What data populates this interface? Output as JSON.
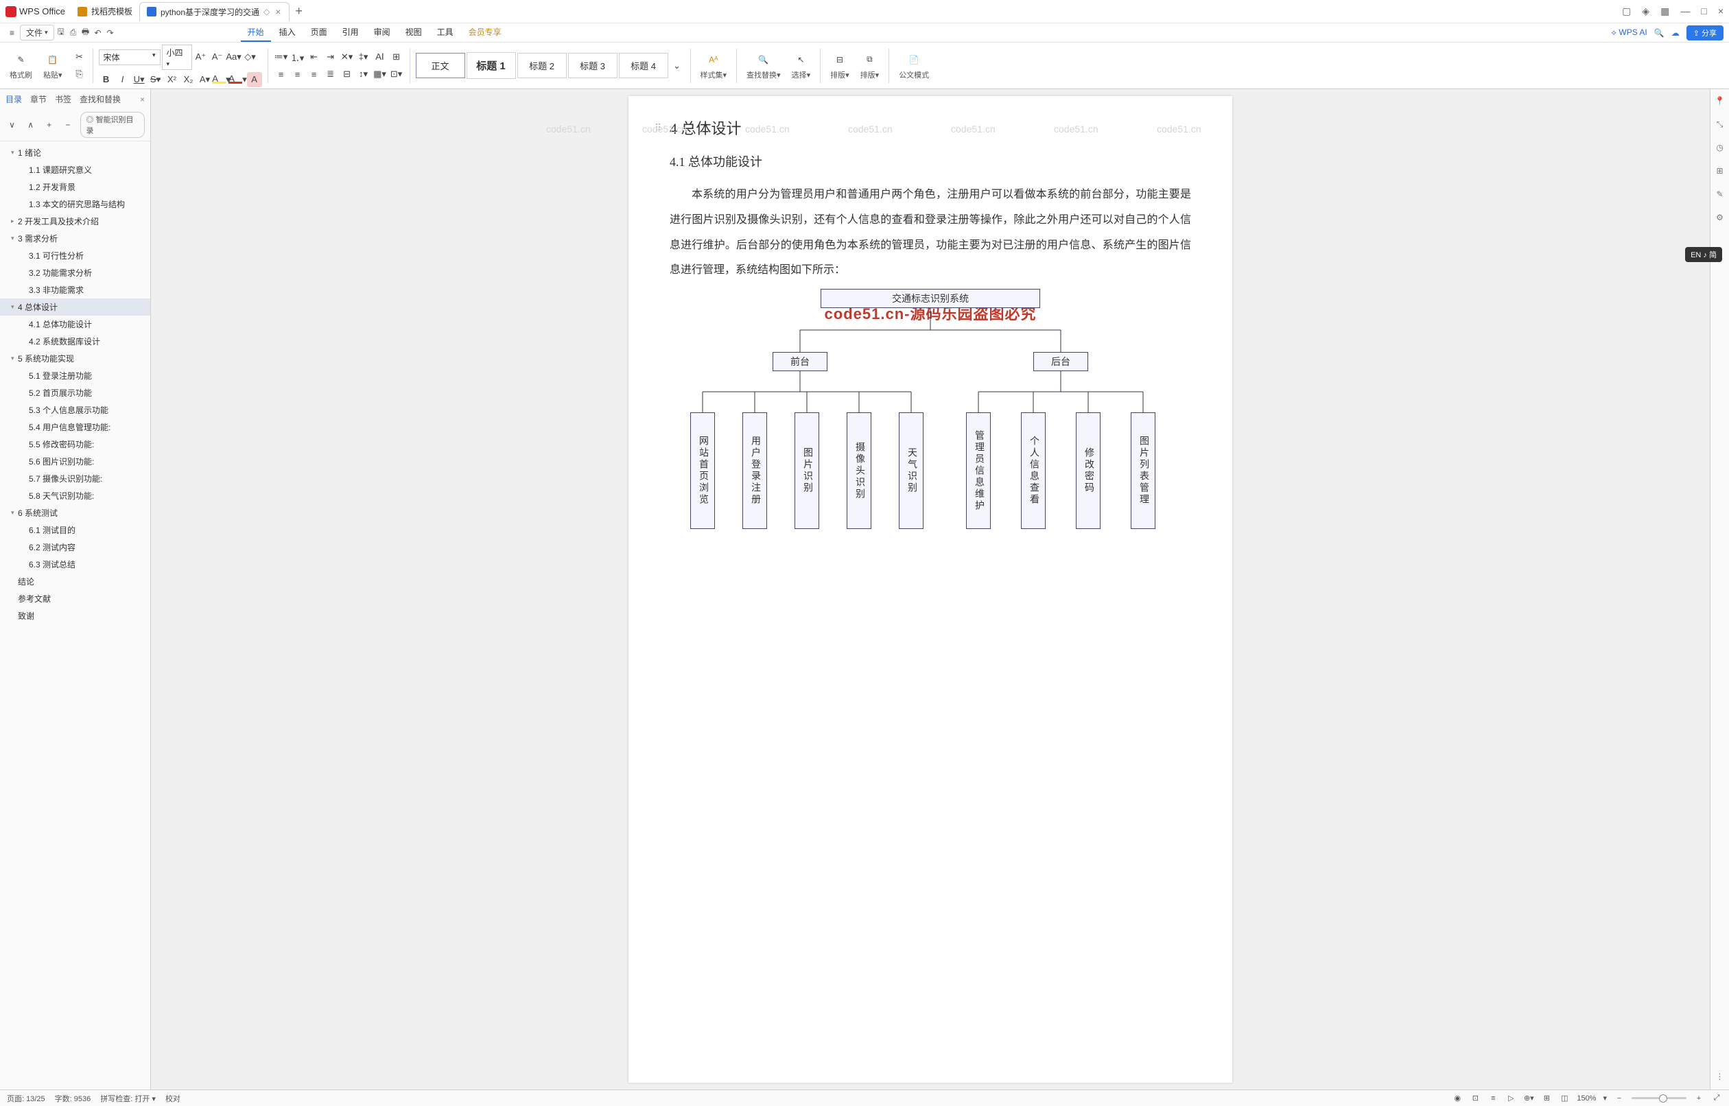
{
  "app": {
    "name": "WPS Office"
  },
  "tabs": [
    {
      "label": "找稻壳模板",
      "icon": "#d48b0c"
    },
    {
      "label": "python基于深度学习的交通",
      "icon": "#2c6fd8",
      "active": true
    }
  ],
  "window_icons": [
    "▢",
    "◈",
    "▦",
    "—",
    "□",
    "×"
  ],
  "file_menu": "文件",
  "quick_icons": [
    "☰",
    "🗋",
    "🖶",
    "↩",
    "↪"
  ],
  "main_tabs": [
    "开始",
    "插入",
    "页面",
    "引用",
    "审阅",
    "视图",
    "工具",
    "会员专享"
  ],
  "wpsai": "WPS AI",
  "share": "分享",
  "ribbon": {
    "format_painter": "格式刷",
    "paste": "粘贴",
    "font_name": "宋体",
    "font_size": "小四",
    "style_set": "样式集",
    "find_replace": "查找替换",
    "select": "选择",
    "arrange": "排版",
    "arrange2": "排版",
    "official": "公文模式",
    "styles": [
      "正文",
      "标题 1",
      "标题 2",
      "标题 3",
      "标题 4"
    ]
  },
  "left_pane": {
    "tabs": [
      "目录",
      "章节",
      "书签",
      "查找和替换"
    ],
    "smart": "智能识别目录",
    "toc": [
      {
        "t": "1 绪论",
        "l": 1,
        "car": "▾"
      },
      {
        "t": "1.1 课题研究意义",
        "l": 2
      },
      {
        "t": "1.2 开发背景",
        "l": 2
      },
      {
        "t": "1.3 本文的研究思路与结构",
        "l": 2
      },
      {
        "t": "2 开发工具及技术介绍",
        "l": 1,
        "car": "▸"
      },
      {
        "t": "3 需求分析",
        "l": 1,
        "car": "▾"
      },
      {
        "t": "3.1 可行性分析",
        "l": 2
      },
      {
        "t": "3.2 功能需求分析",
        "l": 2
      },
      {
        "t": "3.3 非功能需求",
        "l": 2
      },
      {
        "t": "4 总体设计",
        "l": 1,
        "car": "▾",
        "sel": true
      },
      {
        "t": "4.1 总体功能设计",
        "l": 2
      },
      {
        "t": "4.2 系统数据库设计",
        "l": 2
      },
      {
        "t": "5 系统功能实现",
        "l": 1,
        "car": "▾"
      },
      {
        "t": "5.1 登录注册功能",
        "l": 2
      },
      {
        "t": "5.2 首页展示功能",
        "l": 2
      },
      {
        "t": "5.3 个人信息展示功能",
        "l": 2
      },
      {
        "t": "5.4 用户信息管理功能:",
        "l": 2
      },
      {
        "t": "5.5 修改密码功能:",
        "l": 2
      },
      {
        "t": "5.6 图片识别功能:",
        "l": 2
      },
      {
        "t": "5.7 摄像头识别功能:",
        "l": 2
      },
      {
        "t": "5.8 天气识别功能:",
        "l": 2
      },
      {
        "t": "6 系统测试",
        "l": 1,
        "car": "▾"
      },
      {
        "t": "6.1 测试目的",
        "l": 2
      },
      {
        "t": "6.2 测试内容",
        "l": 2
      },
      {
        "t": "6.3 测试总结",
        "l": 2
      },
      {
        "t": "结论",
        "l": 0
      },
      {
        "t": "参考文献",
        "l": 0
      },
      {
        "t": "致谢",
        "l": 0
      }
    ]
  },
  "doc": {
    "h1": "4 总体设计",
    "h2": "4.1 总体功能设计",
    "para": "本系统的用户分为管理员用户和普通用户两个角色，注册用户可以看做本系统的前台部分，功能主要是进行图片识别及摄像头识别，还有个人信息的查看和登录注册等操作，除此之外用户还可以对自己的个人信息进行维护。后台部分的使用角色为本系统的管理员，功能主要为对已注册的用户信息、系统产生的图片信息进行管理，系统结构图如下所示：",
    "watermark": "code51.cn-源码乐园盗图必究",
    "diagram": {
      "root": "交通标志识别系统",
      "mid": [
        "前台",
        "后台"
      ],
      "front": [
        "网站首页浏览",
        "用户登录注册",
        "图片识别",
        "摄像头识别",
        "天气识别"
      ],
      "back": [
        "管理员信息维护",
        "个人信息查看",
        "修改密码",
        "图片列表管理"
      ]
    }
  },
  "status": {
    "page": "页面: 13/25",
    "words": "字数: 9536",
    "spell": "拼写检查: 打开",
    "proof": "校对",
    "zoom": "150%"
  },
  "ime": "EN ♪ 简",
  "wm_text": "code51.cn"
}
